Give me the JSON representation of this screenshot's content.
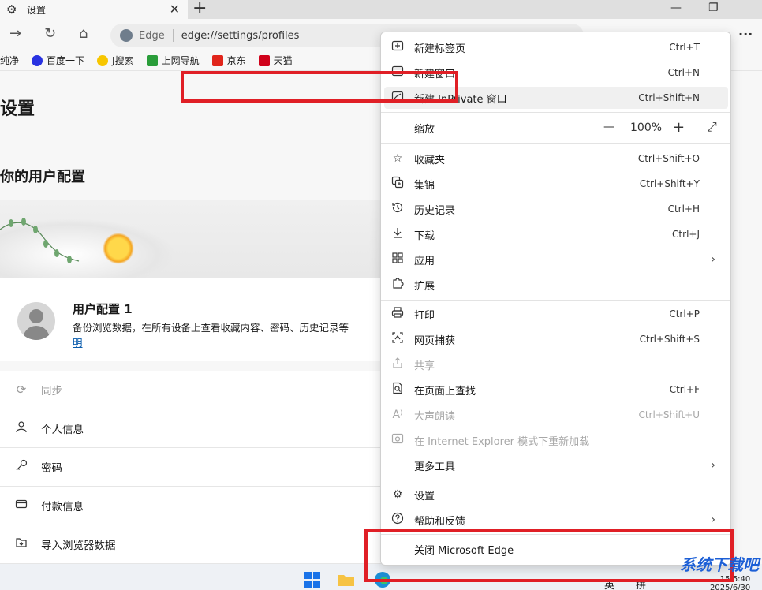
{
  "tab": {
    "title": "设置",
    "close": "✕",
    "gear": "⚙"
  },
  "window": {
    "new_tab": "+",
    "minimize": "—",
    "restore": "❐"
  },
  "toolbar": {
    "forward": "→",
    "refresh": "↻",
    "home": "⌂",
    "more": "···"
  },
  "address": {
    "site_name": "Edge",
    "url": "edge://settings/profiles"
  },
  "favorites": [
    {
      "label": "纯净",
      "color": "#ffffff"
    },
    {
      "label": "百度一下",
      "color": "#2932e1"
    },
    {
      "label": "J搜索",
      "color": "#f7c600"
    },
    {
      "label": "上网导航",
      "color": "#2a9d3a"
    },
    {
      "label": "京东",
      "color": "#e1251b"
    },
    {
      "label": "天猫",
      "color": "#d0021b"
    }
  ],
  "page": {
    "title": "设置",
    "section_title": "你的用户配置",
    "profile_name": "用户配置 1",
    "profile_desc": "备份浏览数据，在所有设备上查看收藏内容、密码、历史记录等",
    "profile_link": "明"
  },
  "settings_list": [
    {
      "label": "同步",
      "icon": "sync-icon",
      "glyph": "⟳",
      "disabled": true
    },
    {
      "label": "个人信息",
      "icon": "person-icon",
      "glyph": "👤",
      "disabled": false
    },
    {
      "label": "密码",
      "icon": "key-icon",
      "glyph": "⚿",
      "disabled": false
    },
    {
      "label": "付款信息",
      "icon": "card-icon",
      "glyph": "▭",
      "disabled": false
    },
    {
      "label": "导入浏览器数据",
      "icon": "import-icon",
      "glyph": "⇲",
      "disabled": false
    }
  ],
  "menu": {
    "new_tab": {
      "label": "新建标签页",
      "shortcut": "Ctrl+T"
    },
    "new_window": {
      "label": "新建窗口",
      "shortcut": "Ctrl+N"
    },
    "new_inprivate": {
      "label": "新建 InPrivate 窗口",
      "shortcut": "Ctrl+Shift+N"
    },
    "zoom": {
      "label": "缩放",
      "value": "100%",
      "minus": "—",
      "plus": "+",
      "fullscreen": "⤢"
    },
    "favorites": {
      "label": "收藏夹",
      "shortcut": "Ctrl+Shift+O"
    },
    "collections": {
      "label": "集锦",
      "shortcut": "Ctrl+Shift+Y"
    },
    "history": {
      "label": "历史记录",
      "shortcut": "Ctrl+H"
    },
    "downloads": {
      "label": "下载",
      "shortcut": "Ctrl+J"
    },
    "apps": {
      "label": "应用",
      "arrow": "›"
    },
    "extensions": {
      "label": "扩展"
    },
    "print": {
      "label": "打印",
      "shortcut": "Ctrl+P"
    },
    "web_capture": {
      "label": "网页捕获",
      "shortcut": "Ctrl+Shift+S"
    },
    "share": {
      "label": "共享"
    },
    "find": {
      "label": "在页面上查找",
      "shortcut": "Ctrl+F"
    },
    "read_aloud": {
      "label": "大声朗读",
      "shortcut": "Ctrl+Shift+U"
    },
    "ie_mode": {
      "label": "在 Internet Explorer 模式下重新加载"
    },
    "more_tools": {
      "label": "更多工具",
      "arrow": "›"
    },
    "settings": {
      "label": "设置"
    },
    "help": {
      "label": "帮助和反馈",
      "arrow": "›"
    },
    "close_edge": {
      "label": "关闭 Microsoft Edge"
    }
  },
  "taskbar": {
    "ime_lang": "英",
    "ime_mode": "拼",
    "time": "15:5:40",
    "date": "2025/6/30"
  },
  "watermark": "系统下载吧",
  "colors": {
    "annotation_red": "#e01f26",
    "link_blue": "#0b5cad"
  }
}
